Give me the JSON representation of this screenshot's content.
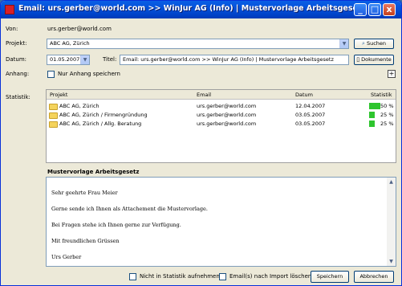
{
  "window": {
    "title": "Email: urs.gerber@world.com >> WinJur AG (Info) | Mustervorlage Arbeitsgesetz",
    "minimize": "_",
    "maximize": "□",
    "close": "x"
  },
  "form": {
    "von_label": "Von:",
    "von_value": "urs.gerber@world.com",
    "projekt_label": "Projekt:",
    "projekt_value": "ABC AG, Zürich",
    "suchen_label": "Suchen",
    "datum_label": "Datum:",
    "datum_value": "01.05.2007",
    "titel_label": "Titel:",
    "titel_value": "Email: urs.gerber@world.com >> WinJur AG (Info) | Mustervorlage Arbeitsgesetz",
    "dokumente_label": "Dokumente",
    "anhang_label": "Anhang:",
    "nur_anhang_label": "Nur Anhang speichern",
    "plus_label": "+"
  },
  "statistik": {
    "label": "Statistik:",
    "headers": [
      "Projekt",
      "Email",
      "Datum",
      "Statistik"
    ],
    "rows": [
      {
        "projekt": "ABC AG, Zürich",
        "email": "urs.gerber@world.com",
        "datum": "12.04.2007",
        "percent": "50 %",
        "value": 50
      },
      {
        "projekt": "ABC AG, Zürich / Firmengründung",
        "email": "urs.gerber@world.com",
        "datum": "03.05.2007",
        "percent": "25 %",
        "value": 25
      },
      {
        "projekt": "ABC AG, Zürich / Allg. Beratung",
        "email": "urs.gerber@world.com",
        "datum": "03.05.2007",
        "percent": "25 %",
        "value": 25
      }
    ]
  },
  "body": {
    "title": "Mustervorlage Arbeitsgesetz",
    "lines": [
      "Sehr geehrte Frau Meier",
      "Gerne sende ich Ihnen als Attachement die Mustervorlage.",
      "Bei Fragen stehe ich Ihnen gerne zur Verfügung.",
      "Mit freundlichen Grüssen",
      "Urs Gerber"
    ]
  },
  "footer": {
    "nicht_statistik": "Nicht in Statistik aufnehmen",
    "emails_loeschen": "Email(s) nach Import löschen",
    "speichern": "Speichern",
    "abbrechen": "Abbrechen"
  },
  "colors": {
    "titlebar": "#0450d8",
    "bar_green": "#2ec52e"
  },
  "icons": [
    "app-icon",
    "search-icon",
    "document-icon",
    "folder-icon",
    "chevron-down-icon"
  ]
}
